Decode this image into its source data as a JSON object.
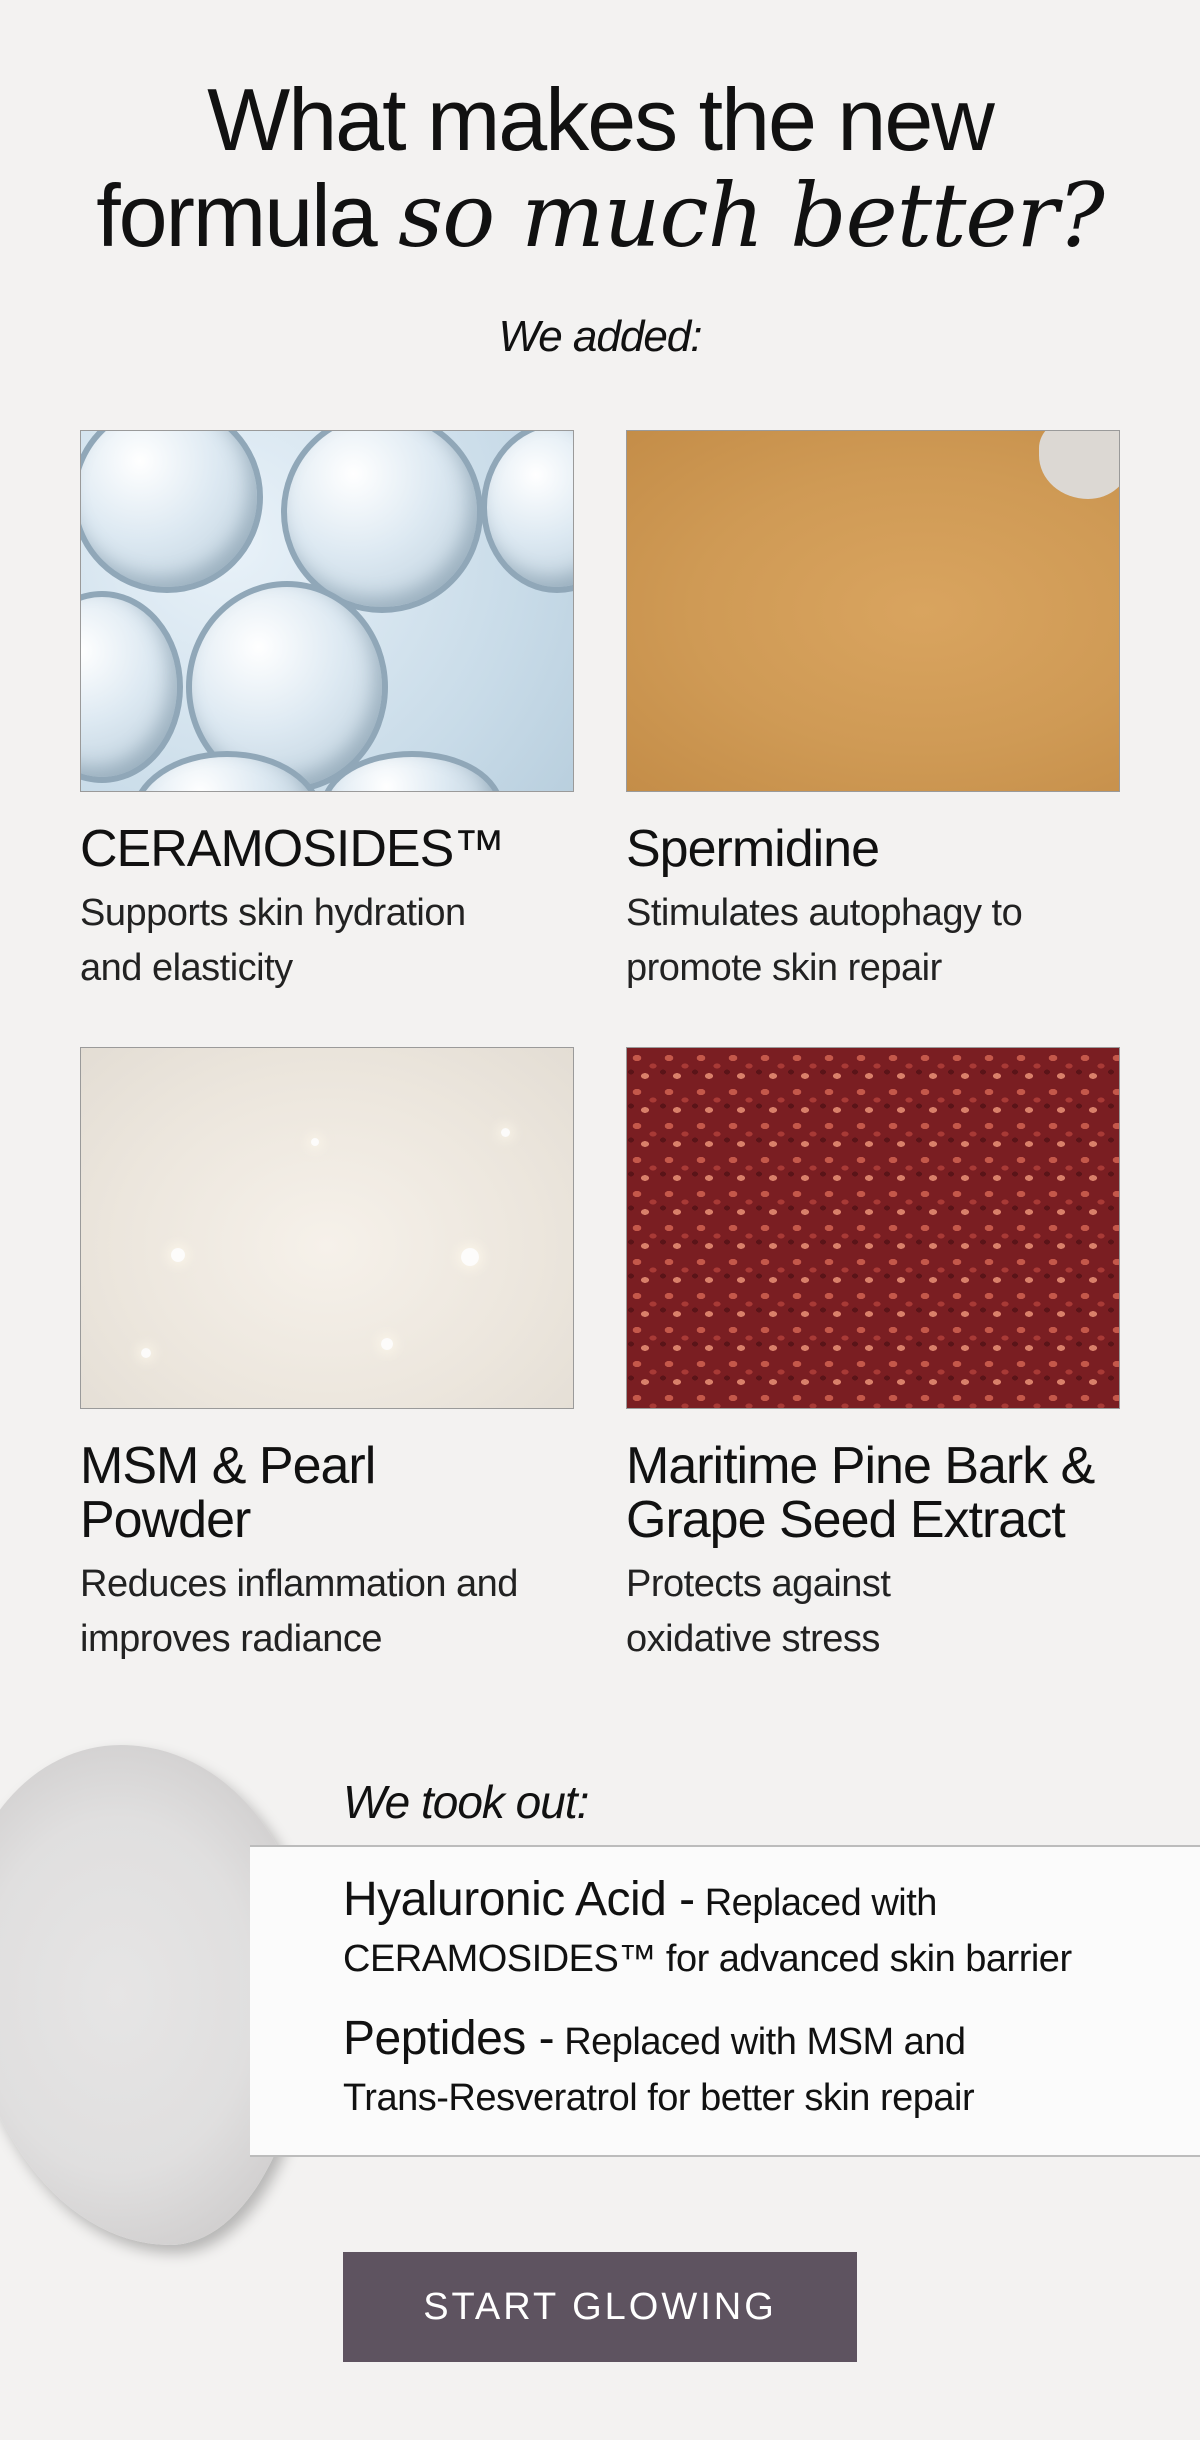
{
  "headline": {
    "line1": "What makes the new",
    "line2_plain": "formula",
    "line2_italic": "so much better?"
  },
  "added": {
    "label": "We added:",
    "items": [
      {
        "name": "CERAMOSIDES™",
        "desc_line1": "Supports skin hydration",
        "desc_line2": "and elasticity"
      },
      {
        "name": "Spermidine",
        "desc_line1": "Stimulates autophagy to",
        "desc_line2": "promote skin repair"
      },
      {
        "name_line1": "MSM & Pearl",
        "name_line2": "Powder",
        "desc_line1": "Reduces inflammation and",
        "desc_line2": "improves radiance"
      },
      {
        "name_line1": "Maritime Pine Bark &",
        "name_line2": "Grape Seed Extract",
        "desc_line1": "Protects against",
        "desc_line2": "oxidative stress"
      }
    ]
  },
  "removed": {
    "label": "We took out:",
    "items": [
      {
        "name": "Hyaluronic Acid -",
        "text_a": "Replaced with",
        "em1": "CERAMOSIDES™",
        "text_b": "for advanced skin barrier"
      },
      {
        "name": "Peptides -",
        "text_a": "Replaced with",
        "em1": "MSM",
        "text_mid": "and",
        "em2": "Trans-Resveratrol",
        "text_b": "for better skin repair"
      }
    ]
  },
  "cta": {
    "label": "START GLOWING"
  },
  "colors": {
    "background": "#f3f2f1",
    "cta": "#5e5360"
  }
}
